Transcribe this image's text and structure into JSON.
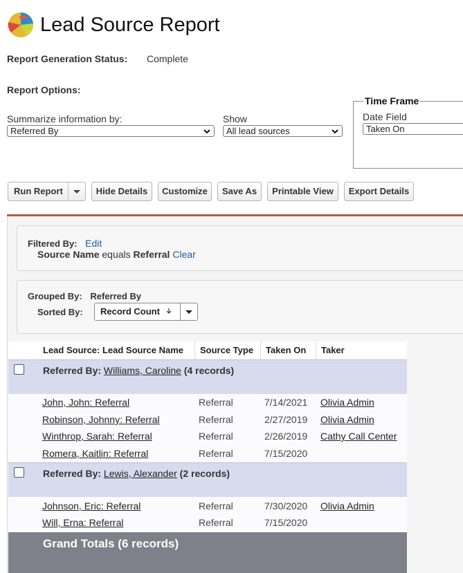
{
  "header": {
    "title": "Lead Source Report"
  },
  "status": {
    "label": "Report Generation Status:",
    "value": "Complete"
  },
  "options": {
    "label": "Report Options:",
    "summarize_label": "Summarize information by:",
    "summarize_value": "Referred By",
    "show_label": "Show",
    "show_value": "All lead sources"
  },
  "timeframe": {
    "legend": "Time Frame",
    "date_field_label": "Date Field",
    "date_field_value": "Taken On"
  },
  "toolbar": {
    "run_report": "Run Report",
    "hide_details": "Hide Details",
    "customize": "Customize",
    "save_as": "Save As",
    "printable_view": "Printable View",
    "export_details": "Export Details"
  },
  "filter": {
    "label": "Filtered By:",
    "edit": "Edit",
    "field": "Source Name",
    "operator": "equals",
    "value": "Referral",
    "clear": "Clear"
  },
  "grouping": {
    "grouped_label": "Grouped By:",
    "grouped_value": "Referred By",
    "sorted_label": "Sorted By:",
    "sorted_value": "Record Count"
  },
  "table": {
    "columns": [
      "Lead Source: Lead Source Name",
      "Source Type",
      "Taken On",
      "Taker"
    ],
    "groups": [
      {
        "label": "Referred By:",
        "name": "Williams, Caroline",
        "count": "(4 records)",
        "rows": [
          {
            "name": "John, John: Referral",
            "type": "Referral",
            "date": "7/14/2021",
            "taker": "Olivia Admin"
          },
          {
            "name": "Robinson, Johnny: Referral",
            "type": "Referral",
            "date": "2/27/2019",
            "taker": "Olivia Admin"
          },
          {
            "name": "Winthrop, Sarah: Referral",
            "type": "Referral",
            "date": "2/26/2019",
            "taker": "Cathy Call Center"
          },
          {
            "name": "Romera, Kaitlin: Referral",
            "type": "Referral",
            "date": "7/15/2020",
            "taker": ""
          }
        ]
      },
      {
        "label": "Referred By:",
        "name": "Lewis, Alexander",
        "count": "(2 records)",
        "rows": [
          {
            "name": "Johnson, Eric: Referral",
            "type": "Referral",
            "date": "7/30/2020",
            "taker": "Olivia Admin"
          },
          {
            "name": "Will, Erna: Referral",
            "type": "Referral",
            "date": "7/15/2020",
            "taker": ""
          }
        ]
      }
    ],
    "grand_totals": "Grand Totals (6 records)"
  },
  "icons": {
    "logo": "pie-chart-logo-icon",
    "dropdown": "chevron-down-icon",
    "sort": "sort-down-arrow-icon"
  },
  "colors": {
    "accent_rule": "#b35c44",
    "group_row": "#d6dcee",
    "grand_totals": "#7f8089",
    "link": "#1a5d9e"
  }
}
